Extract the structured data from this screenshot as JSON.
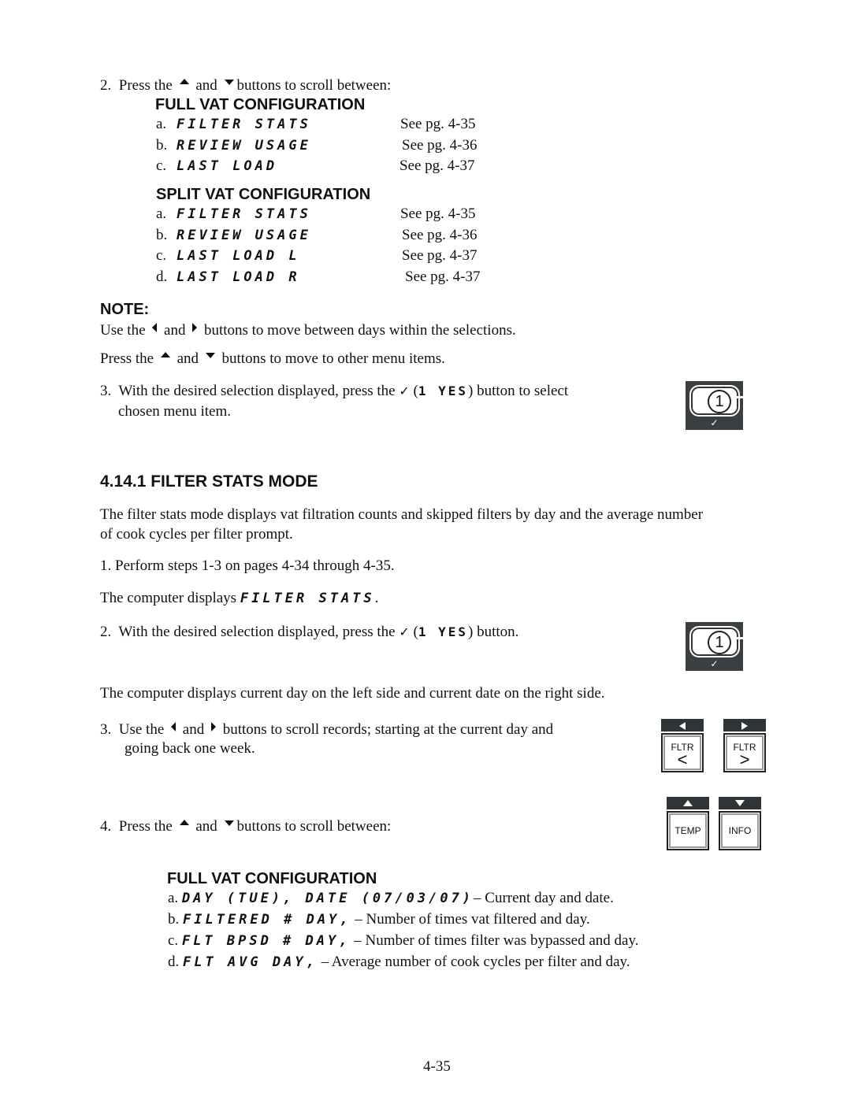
{
  "step2_top": {
    "num": "2.",
    "pre": "Press the",
    "mid": "and",
    "post": "buttons to scroll between:",
    "full_vat": {
      "heading": "FULL VAT CONFIGURATION",
      "items": [
        {
          "label": "a.",
          "display": "FILTER STATS",
          "ref": "See pg. 4-35"
        },
        {
          "label": "b.",
          "display": "REVIEW USAGE",
          "ref": "See pg. 4-36"
        },
        {
          "label": "c.",
          "display": "LAST LOAD",
          "ref": "See pg. 4-37"
        }
      ]
    },
    "split_vat": {
      "heading": "SPLIT VAT CONFIGURATION",
      "items": [
        {
          "label": "a.",
          "display": "FILTER STATS",
          "ref": "See pg. 4-35"
        },
        {
          "label": "b.",
          "display": "REVIEW USAGE",
          "ref": "See pg. 4-36"
        },
        {
          "label": "c.",
          "display": "LAST LOAD L",
          "ref": "See pg. 4-37"
        },
        {
          "label": "d.",
          "display": "LAST LOAD R",
          "ref": "See pg. 4-37"
        }
      ]
    }
  },
  "note": {
    "heading": "NOTE:",
    "line1_pre": "Use the",
    "line1_mid": "and",
    "line1_post": "buttons to move between days within the selections.",
    "line2_pre": "Press the",
    "line2_mid": "and",
    "line2_post": "buttons to move to other menu items."
  },
  "step3_top": {
    "num": "3.",
    "pre": "With the desired selection displayed, press the",
    "check": "✓",
    "paren_open": "(",
    "display": "1 YES",
    "post": ") button to select",
    "line2": "chosen menu item."
  },
  "button_yes": {
    "number": "1",
    "check": "✓"
  },
  "section": {
    "title": "4.14.1  FILTER STATS MODE",
    "intro_line1": "The filter stats mode displays vat filtration counts and skipped filters by day and the average number",
    "intro_line2": "of cook cycles per filter prompt.",
    "step1": "1.  Perform steps 1-3 on pages 4-34 through 4-35.",
    "displays_pre": "The computer displays",
    "displays_value": "FILTER STATS",
    "displays_post": ".",
    "step2": {
      "num": "2.",
      "pre": "With the desired selection displayed, press the",
      "check": "✓",
      "paren_open": "(",
      "display": "1 YES",
      "post": ") button."
    },
    "current_day_text": "The computer displays current day on the left side and current date on the right side.",
    "step3": {
      "num": "3.",
      "pre": "Use the",
      "mid": "and",
      "post": "buttons to scroll records; starting at the current day and",
      "line2": "going back one week."
    },
    "step4": {
      "num": "4.",
      "pre": "Press the",
      "mid": "and",
      "post": "buttons to scroll between:"
    },
    "full_vat": {
      "heading": "FULL VAT CONFIGURATION",
      "items": [
        {
          "label": "a.",
          "display": "DAY (TUE), DATE (07/03/07)",
          "desc": "– Current day and date."
        },
        {
          "label": "b.",
          "display": "FILTERED # DAY,",
          "desc": "– Number of times vat filtered and day."
        },
        {
          "label": "c.",
          "display": "FLT BPSD # DAY,",
          "desc": "– Number of times filter was bypassed and day."
        },
        {
          "label": "d.",
          "display": "FLT AVG DAY,",
          "desc": "– Average number of cook cycles per filter and day."
        }
      ]
    }
  },
  "keys": {
    "fltr_left": {
      "label": "FLTR",
      "symbol": "<"
    },
    "fltr_right": {
      "label": "FLTR",
      "symbol": ">"
    },
    "temp": {
      "label": "TEMP"
    },
    "info": {
      "label": "INFO"
    }
  },
  "page_number": "4-35"
}
